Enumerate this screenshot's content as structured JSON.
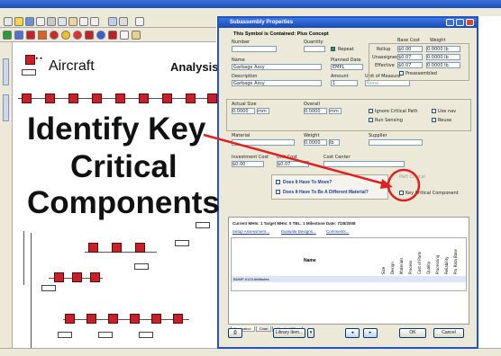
{
  "app": {
    "menu": [
      "File",
      "Edit",
      "View",
      "Browse",
      "Tools",
      "Special Areas",
      "Window",
      "Help"
    ]
  },
  "canvas": {
    "root_label": "Aircraft",
    "analysis_label": "Analysis"
  },
  "overlay": {
    "line1": "Identify Key",
    "line2": "Critical",
    "line3": "Components"
  },
  "dialog": {
    "title": "Subassembly Properties",
    "subtitle": "This Symbol is Contained: Plus Concept",
    "number_label": "Number",
    "quantity_label": "Quantity",
    "repeat_label": "Repeat",
    "name_label": "Name",
    "name_value": "Garbage Assy",
    "planned_date_label": "Planned Date",
    "planned_date_value": "EMPL",
    "description_label": "Description",
    "description_value": "Garbage Assy",
    "amount_label": "Amount",
    "amount_value": "1",
    "unit_label": "Unit of Measure",
    "unit_value": "None",
    "cost_header": "Base Cost",
    "weight_header": "Weight",
    "rollup_label": "Rollup",
    "rollup_cost": "$0.00",
    "rollup_weight": "0.0000 lb",
    "unassigned_label": "Unassigned",
    "unassigned_cost": "$0.07",
    "unassigned_weight": "0.0000 lb",
    "effective_label": "Effective",
    "effective_cost": "$0.07",
    "effective_weight": "0.0000 lb",
    "preassembled_label": "Preassembled",
    "actual_size_label": "Actual Size",
    "actual_size_value": "0.0000",
    "actual_size_unit": "mm",
    "overall_label": "Overall",
    "overall_value": "0.0000",
    "overall_unit": "mm",
    "ignore_critical_label": "Ignore Critical Path",
    "use_nav_label": "Use nav",
    "run_sensing_label": "Run Sensing",
    "reuse_label": "Reuse",
    "material_label": "Material",
    "weight_label": "Weight",
    "weight_value": "0.0000",
    "weight_unit": "lb",
    "supplier_label": "Supplier",
    "investment_cost_label": "Investment Cost",
    "investment_cost_value": "$0.00",
    "unit_cost_label": "Unit Cost",
    "unit_cost_value": "$0.07",
    "cost_center_label": "Cost Center",
    "option1": "Does It Have To Move?",
    "option2": "Does It Have To Be A Different Material?",
    "critical_label": "Part Critical",
    "key_critical_label": "Key Critical Component",
    "tabs": [
      "Scoring",
      "DFA",
      "Quality",
      "Multimedia",
      "Categories & Custom Fields",
      "Graphic",
      "Notes"
    ],
    "active_tab_index": 1,
    "metrics": "Current MHIs: 1   Target MHIs: 0   TBL: 1   Milestone Date: 7/28/2008",
    "link1": "Setup Assessment...",
    "link2": "Evaluate Designs...",
    "link3": "Comments...",
    "table_header_name": "Name",
    "table_cols": [
      "Size",
      "Design",
      "Materials",
      "Process",
      "Cost of Parts",
      "Quality",
      "Processing",
      "Reliability",
      "Pro Rata Base"
    ],
    "table_row": "BUMP-0123 Attributes",
    "subtabs": [
      "Evaluation",
      "Chart",
      "Attached Files"
    ],
    "library_btn": "Library Item...",
    "ok_btn": "OK",
    "cancel_btn": "Cancel"
  },
  "colors": {
    "accent": "#c8202a",
    "title_blue": "#2453c8"
  }
}
